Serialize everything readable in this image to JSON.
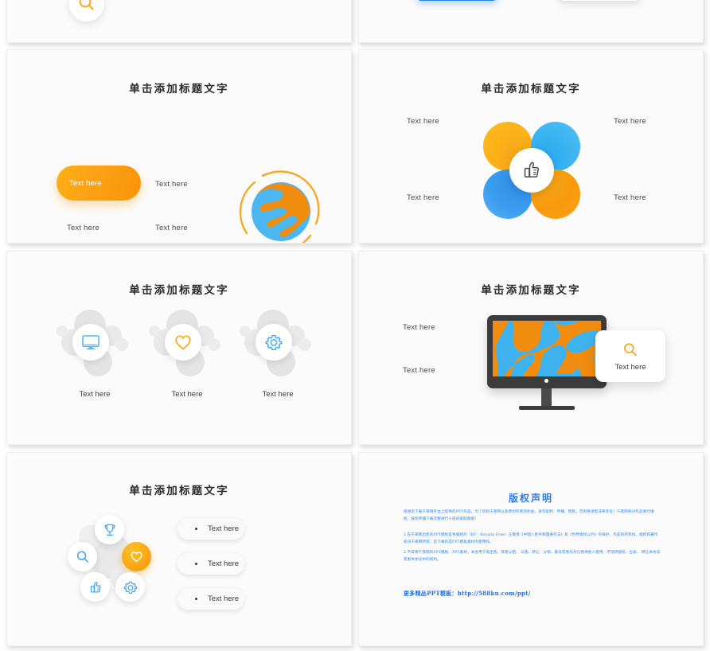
{
  "deck": {
    "slide_title": "单击添加标题文字",
    "text_here": "Text here"
  },
  "slides": [
    {
      "index": 1,
      "kind": "partial-top-left",
      "icons": [
        "search-icon"
      ]
    },
    {
      "index": 2,
      "kind": "partial-top-right",
      "buttons": [
        "blue-button",
        "white-button"
      ]
    },
    {
      "index": 3,
      "kind": "pill-and-globe",
      "title": "单击添加标题文字",
      "pill_label": "Text here",
      "labels": [
        "Text here",
        "Text here",
        "Text here"
      ],
      "graphic": "globe-icon"
    },
    {
      "index": 4,
      "kind": "four-petal",
      "title": "单击添加标题文字",
      "labels": [
        "Text here",
        "Text here",
        "Text here",
        "Text here"
      ],
      "center_icon": "thumbs-up-icon",
      "petals": [
        "orange",
        "light-blue",
        "blue",
        "orange"
      ]
    },
    {
      "index": 5,
      "kind": "three-icon-clusters",
      "title": "单击添加标题文字",
      "items": [
        {
          "icon": "monitor-icon",
          "label": "Text here"
        },
        {
          "icon": "heart-icon",
          "label": "Text here"
        },
        {
          "icon": "gear-icon",
          "label": "Text here"
        }
      ]
    },
    {
      "index": 6,
      "kind": "monitor",
      "title": "单击添加标题文字",
      "labels": [
        "Text here",
        "Text here"
      ],
      "card": {
        "icon": "search-icon",
        "label": "Text here"
      }
    },
    {
      "index": 7,
      "kind": "icon-ring-bullets",
      "title": "单击添加标题文字",
      "ring_icons": [
        "trophy-icon",
        "heart-icon",
        "gear-icon",
        "thumbs-up-icon",
        "search-icon"
      ],
      "bullets": [
        "Text here",
        "Text here",
        "Text here"
      ]
    },
    {
      "index": 8,
      "kind": "copyright",
      "title": "版权声明",
      "paragraph1": "感谢您下载千库网平台上提供的PPT作品，为了您和千库网以及原创作者的利益，请勿复制、传播、销售，否则将承担法律责任！千库网将对作品进行维权，按照传播下载次数进行十倍的索取赔偿！",
      "paragraph2": "1.在千库网出售的PPT模板是免版权的（RF：Royalty-Free）正版受《中国人民共和国著作法》和《世界版权公约》的保护，作品的所有权、版权和著作权归千库网所有，您下载的是PPT模板素材的使用权。",
      "paragraph3": "2.不得将千库网的PPT模板、PPT素材，本身用于再出售，或者以租、 以售、转让、分销、重号或者作为礼物供他人使用，不得转授权、出表、 明让本协议或者本协议中的权利。",
      "link": "更多精品PPT模板：http://588ku.com/ppt/"
    }
  ]
}
